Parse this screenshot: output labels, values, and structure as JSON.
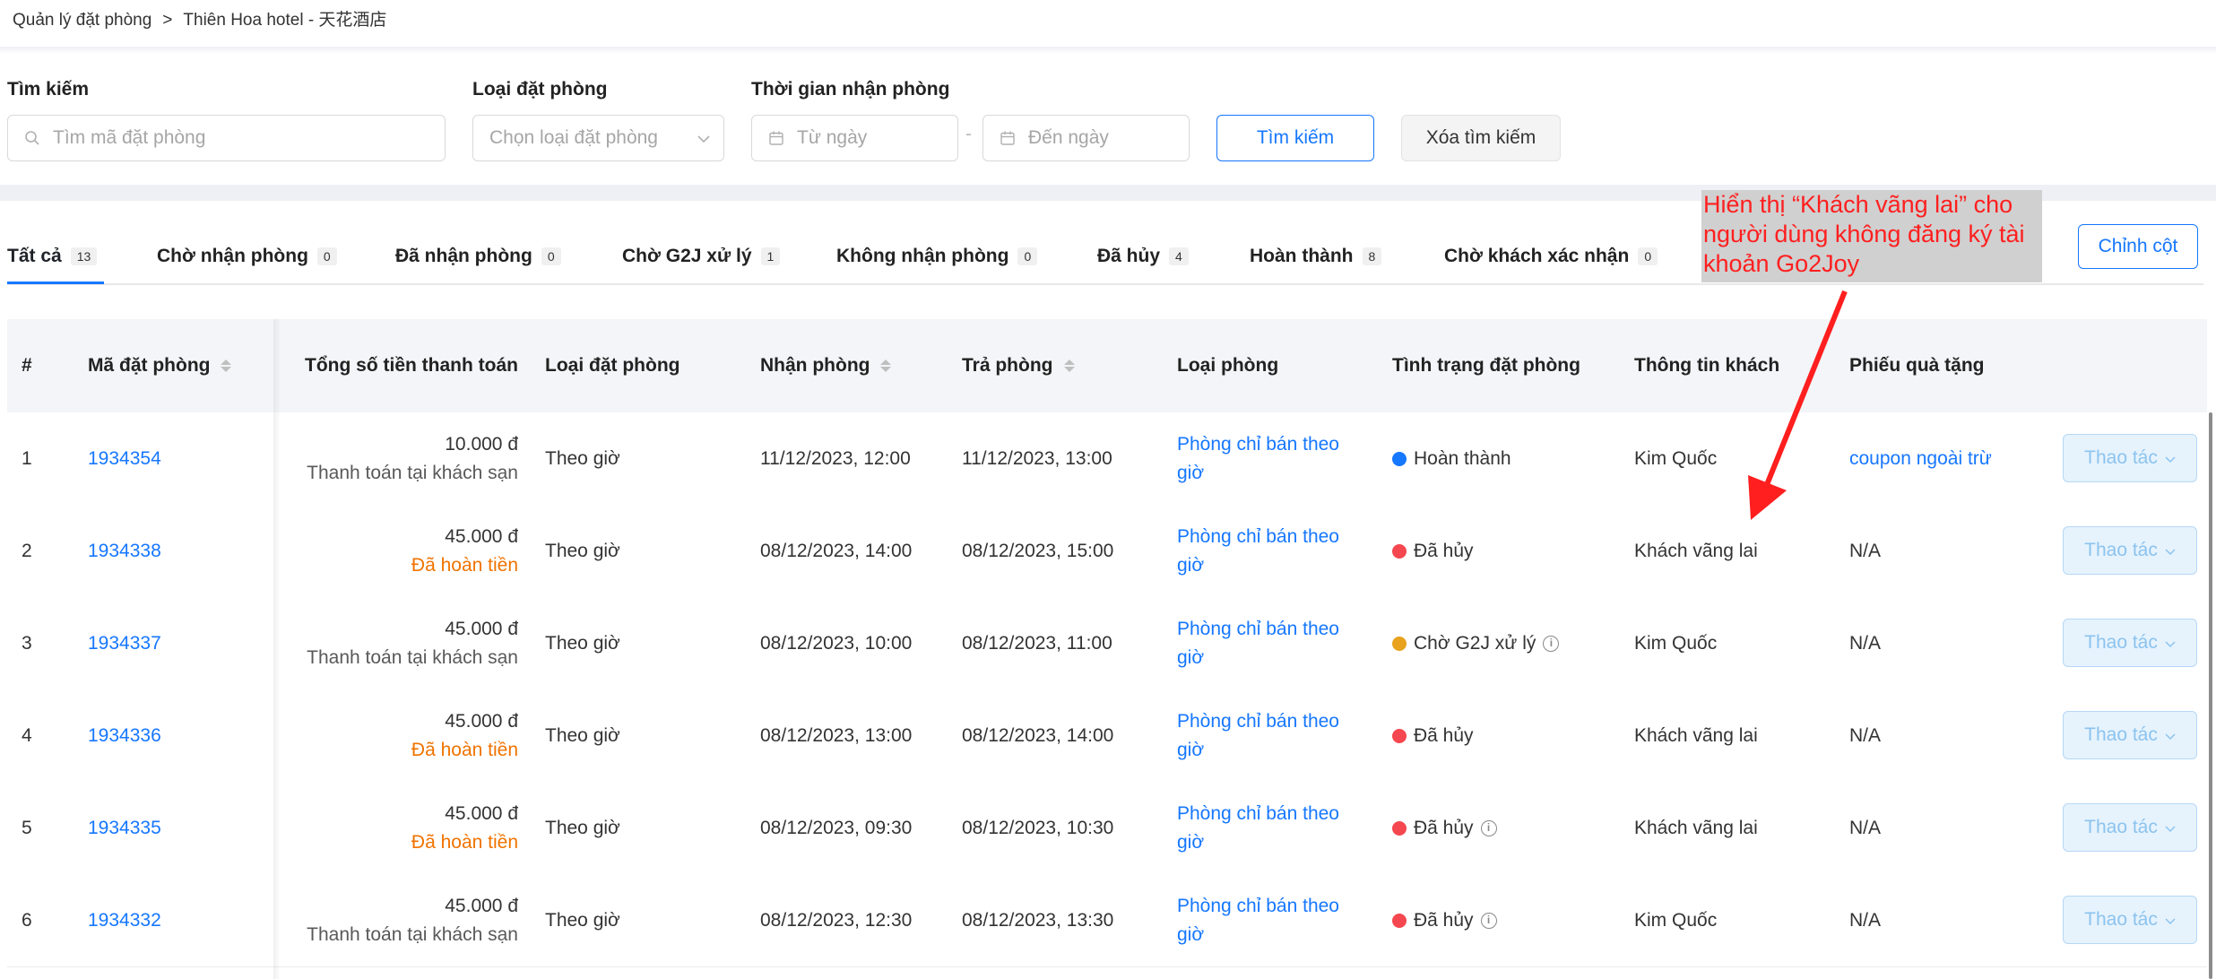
{
  "breadcrumb": {
    "root": "Quản lý đặt phòng",
    "separator": ">",
    "current": "Thiên Hoa hotel - 天花酒店"
  },
  "filters": {
    "search_label": "Tìm kiếm",
    "search_placeholder": "Tìm mã đặt phòng",
    "type_label": "Loại đặt phòng",
    "type_placeholder": "Chọn loại đặt phòng",
    "time_label": "Thời gian nhận phòng",
    "from_placeholder": "Từ ngày",
    "range_separator": "-",
    "to_placeholder": "Đến ngày",
    "search_button": "Tìm kiếm",
    "clear_button": "Xóa tìm kiếm"
  },
  "tabs": [
    {
      "label": "Tất cả",
      "count": "13"
    },
    {
      "label": "Chờ nhận phòng",
      "count": "0"
    },
    {
      "label": "Đã nhận phòng",
      "count": "0"
    },
    {
      "label": "Chờ G2J xử lý",
      "count": "1"
    },
    {
      "label": "Không nhận phòng",
      "count": "0"
    },
    {
      "label": "Đã hủy",
      "count": "4"
    },
    {
      "label": "Hoàn thành",
      "count": "8"
    },
    {
      "label": "Chờ khách xác nhận",
      "count": "0"
    }
  ],
  "edit_columns": "Chỉnh cột",
  "annotation": "Hiển thị “Khách vãng lai” cho người dùng không đăng ký tài khoản Go2Joy",
  "columns": {
    "index": "#",
    "code": "Mã đặt phòng",
    "total": "Tổng số tiền thanh toán",
    "booking_type": "Loại đặt phòng",
    "checkin": "Nhận phòng",
    "checkout": "Trả phòng",
    "room_type": "Loại phòng",
    "status": "Tình trạng đặt phòng",
    "guest": "Thông tin khách",
    "gift": "Phiếu quà tặng"
  },
  "rows": [
    {
      "index": "1",
      "code": "1934354",
      "amount": "10.000 đ",
      "payment": "Thanh toán tại khách sạn",
      "payment_kind": "hotel",
      "booking_type": "Theo giờ",
      "checkin": "11/12/2023, 12:00",
      "checkout": "11/12/2023, 13:00",
      "room_line1": "Phòng chỉ bán theo",
      "room_line2": "giờ",
      "status": "Hoàn thành",
      "status_color": "#1677ff",
      "status_info": false,
      "guest": "Kim Quốc",
      "gift": "coupon ngoài trừ",
      "gift_link": true,
      "action": "Thao tác"
    },
    {
      "index": "2",
      "code": "1934338",
      "amount": "45.000 đ",
      "payment": "Đã hoàn tiền",
      "payment_kind": "refund",
      "booking_type": "Theo giờ",
      "checkin": "08/12/2023, 14:00",
      "checkout": "08/12/2023, 15:00",
      "room_line1": "Phòng chỉ bán theo",
      "room_line2": "giờ",
      "status": "Đã hủy",
      "status_color": "#f5474f",
      "status_info": false,
      "guest": "Khách vãng lai",
      "gift": "N/A",
      "gift_link": false,
      "action": "Thao tác"
    },
    {
      "index": "3",
      "code": "1934337",
      "amount": "45.000 đ",
      "payment": "Thanh toán tại khách sạn",
      "payment_kind": "hotel",
      "booking_type": "Theo giờ",
      "checkin": "08/12/2023, 10:00",
      "checkout": "08/12/2023, 11:00",
      "room_line1": "Phòng chỉ bán theo",
      "room_line2": "giờ",
      "status": "Chờ G2J xử lý",
      "status_color": "#e8a21d",
      "status_info": true,
      "guest": "Kim Quốc",
      "gift": "N/A",
      "gift_link": false,
      "action": "Thao tác"
    },
    {
      "index": "4",
      "code": "1934336",
      "amount": "45.000 đ",
      "payment": "Đã hoàn tiền",
      "payment_kind": "refund",
      "booking_type": "Theo giờ",
      "checkin": "08/12/2023, 13:00",
      "checkout": "08/12/2023, 14:00",
      "room_line1": "Phòng chỉ bán theo",
      "room_line2": "giờ",
      "status": "Đã hủy",
      "status_color": "#f5474f",
      "status_info": false,
      "guest": "Khách vãng lai",
      "gift": "N/A",
      "gift_link": false,
      "action": "Thao tác"
    },
    {
      "index": "5",
      "code": "1934335",
      "amount": "45.000 đ",
      "payment": "Đã hoàn tiền",
      "payment_kind": "refund",
      "booking_type": "Theo giờ",
      "checkin": "08/12/2023, 09:30",
      "checkout": "08/12/2023, 10:30",
      "room_line1": "Phòng chỉ bán theo",
      "room_line2": "giờ",
      "status": "Đã hủy",
      "status_color": "#f5474f",
      "status_info": true,
      "guest": "Khách vãng lai",
      "gift": "N/A",
      "gift_link": false,
      "action": "Thao tác"
    },
    {
      "index": "6",
      "code": "1934332",
      "amount": "45.000 đ",
      "payment": "Thanh toán tại khách sạn",
      "payment_kind": "hotel",
      "booking_type": "Theo giờ",
      "checkin": "08/12/2023, 12:30",
      "checkout": "08/12/2023, 13:30",
      "room_line1": "Phòng chỉ bán theo",
      "room_line2": "giờ",
      "status": "Đã hủy",
      "status_color": "#f5474f",
      "status_info": true,
      "guest": "Kim Quốc",
      "gift": "N/A",
      "gift_link": false,
      "action": "Thao tác"
    }
  ]
}
